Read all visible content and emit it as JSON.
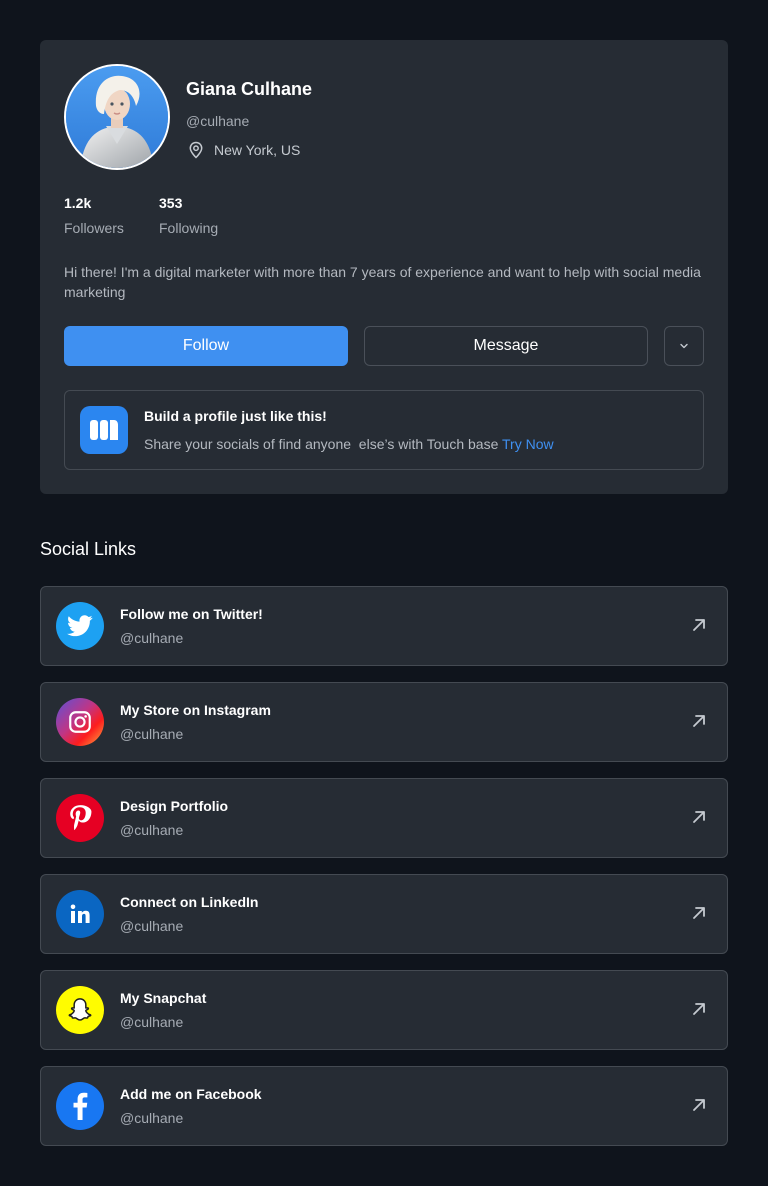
{
  "profile": {
    "name": "Giana Culhane",
    "handle": "@culhane",
    "location": "New York, US",
    "stats": [
      {
        "value": "1.2k",
        "label": "Followers"
      },
      {
        "value": "353",
        "label": "Following"
      }
    ],
    "bio": "Hi there! I'm a digital marketer with more than 7 years of experience and want to help with social media marketing",
    "follow_label": "Follow",
    "message_label": "Message",
    "more_icon": "chevron-down-icon"
  },
  "promo": {
    "title": "Build a profile just like this!",
    "description": "Share your socials of find anyone  else’s with Touch base ",
    "link_label": "Try Now"
  },
  "social": {
    "section_title": "Social Links",
    "items": [
      {
        "title": "Follow me on Twitter!",
        "handle": "@culhane",
        "icon": "twitter-icon",
        "color": "#1da1f2"
      },
      {
        "title": "My Store on Instagram",
        "handle": "@culhane",
        "icon": "instagram-icon",
        "color": "#c13584"
      },
      {
        "title": "Design Portfolio",
        "handle": "@culhane",
        "icon": "pinterest-icon",
        "color": "#e60023"
      },
      {
        "title": "Connect on LinkedIn",
        "handle": "@culhane",
        "icon": "linkedin-icon",
        "color": "#0a66c2"
      },
      {
        "title": "My Snapchat",
        "handle": "@culhane",
        "icon": "snapchat-icon",
        "color": "#fffc00"
      },
      {
        "title": "Add me on Facebook",
        "handle": "@culhane",
        "icon": "facebook-icon",
        "color": "#1877f2"
      }
    ]
  },
  "colors": {
    "background": "#0f141c",
    "card": "#262c34",
    "accent": "#3f90f1"
  }
}
